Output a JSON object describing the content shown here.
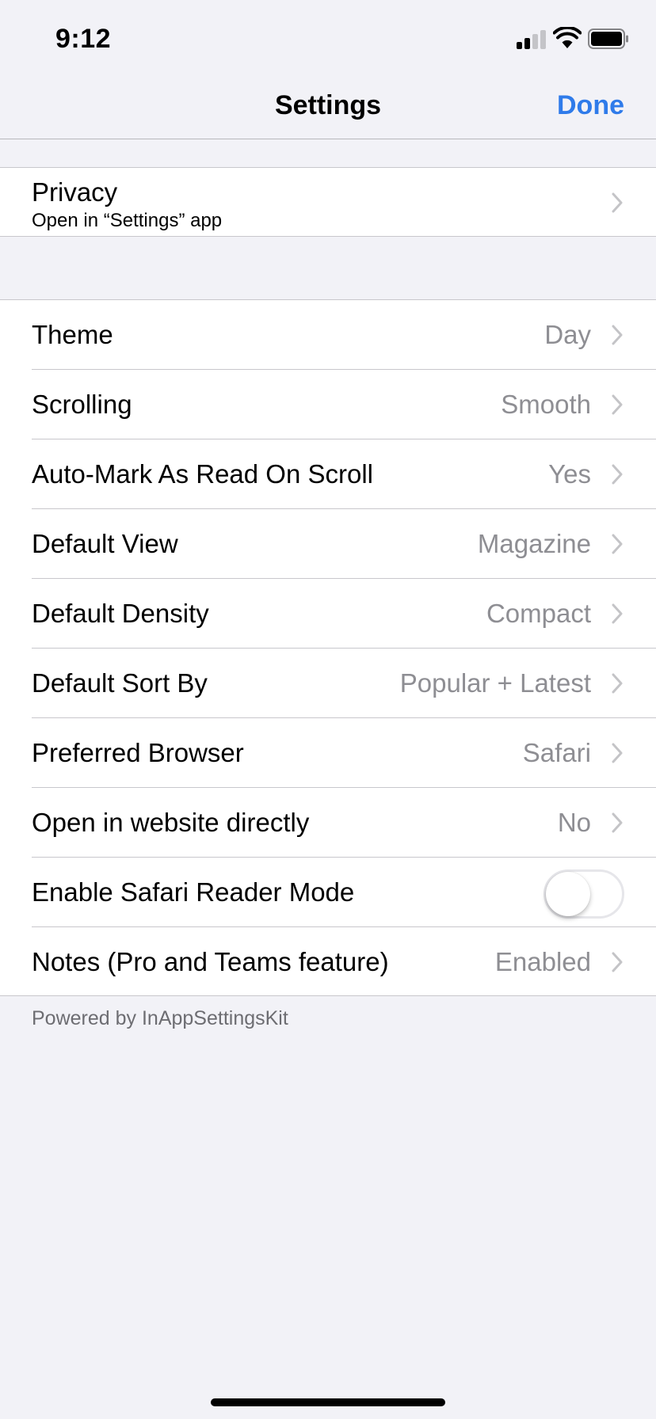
{
  "status_bar": {
    "time": "9:12"
  },
  "nav": {
    "title": "Settings",
    "done_label": "Done",
    "accent_color": "#2f7bea"
  },
  "privacy": {
    "title": "Privacy",
    "subtitle": "Open in “Settings” app"
  },
  "settings": [
    {
      "label": "Theme",
      "value": "Day"
    },
    {
      "label": "Scrolling",
      "value": "Smooth"
    },
    {
      "label": "Auto-Mark As Read On Scroll",
      "value": "Yes"
    },
    {
      "label": "Default View",
      "value": "Magazine"
    },
    {
      "label": "Default Density",
      "value": "Compact"
    },
    {
      "label": "Default Sort By",
      "value": "Popular + Latest"
    },
    {
      "label": "Preferred Browser",
      "value": "Safari"
    },
    {
      "label": "Open in website directly",
      "value": "No"
    },
    {
      "label": "Enable Safari Reader Mode",
      "toggle": false
    },
    {
      "label": "Notes (Pro and Teams feature)",
      "value": "Enabled"
    }
  ],
  "footer": {
    "text": "Powered by InAppSettingsKit"
  },
  "icons": [
    "signal-icon",
    "wifi-icon",
    "battery-icon",
    "chevron-right-icon"
  ]
}
